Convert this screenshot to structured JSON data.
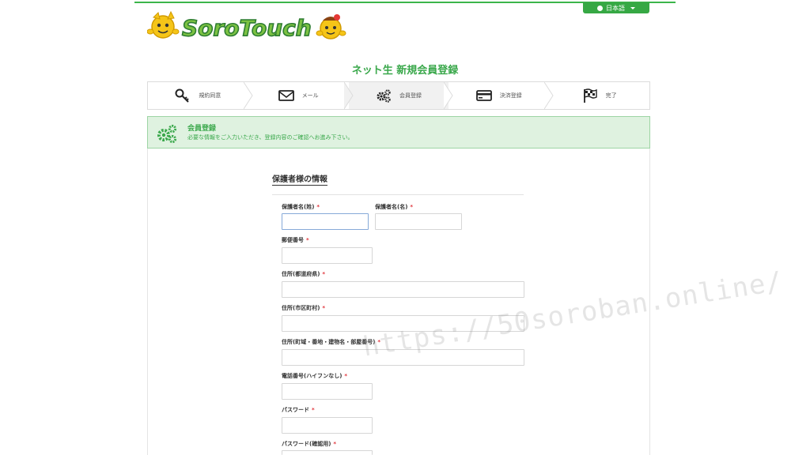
{
  "header": {
    "language_label": "日本語",
    "logo_text": "SoroTouch"
  },
  "page_title": "ネット生 新規会員登録",
  "steps": [
    {
      "label": "規約同意",
      "icon": "key-icon"
    },
    {
      "label": "メール",
      "icon": "envelope-icon"
    },
    {
      "label": "会員登録",
      "icon": "gears-icon",
      "active": true
    },
    {
      "label": "決済登録",
      "icon": "credit-card-icon"
    },
    {
      "label": "完了",
      "icon": "checkered-flag-icon"
    }
  ],
  "notice": {
    "title": "会員登録",
    "description": "必要な情報をご入力いただき、登録内容のご確認へお進み下さい。"
  },
  "form": {
    "section_title": "保護者様の情報",
    "required_mark": "*",
    "fields": {
      "last_name": "保護者名(姓)",
      "first_name": "保護者名(名)",
      "postal_code": "郵便番号",
      "prefecture": "住所(都道府県)",
      "city": "住所(市区町村)",
      "street": "住所(町域・番地・建物名・部屋番号)",
      "phone": "電話番号(ハイフンなし)",
      "password": "パスワード",
      "password_confirm": "パスワード(確認用)"
    }
  },
  "watermark": "https://50soroban.online/",
  "colors": {
    "brand_green": "#3aa84b",
    "notice_bg": "#dff2e0",
    "required_red": "#e0333a"
  }
}
